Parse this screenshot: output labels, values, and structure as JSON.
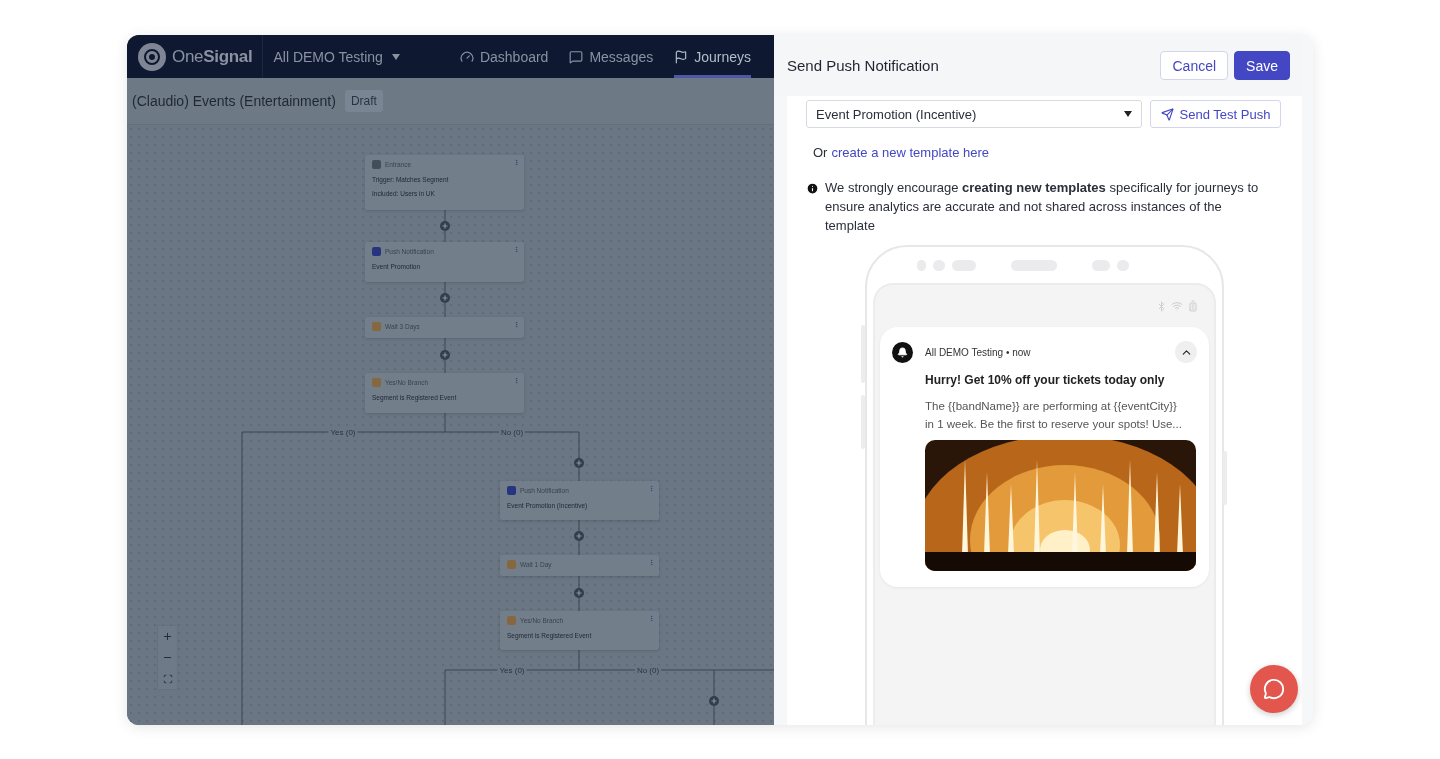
{
  "navbar": {
    "logo": "One**Signal**",
    "app_selector": "All DEMO Testing",
    "nav_items": [
      {
        "kind": "dashboard",
        "label": "Dashboard",
        "selected": false
      },
      {
        "kind": "messages",
        "label": "Messages",
        "selected": false
      },
      {
        "kind": "journeys",
        "label": "Journeys",
        "selected": true
      }
    ]
  },
  "journey": {
    "title": "(Claudio) Events (Entertainment)",
    "status": "Draft"
  },
  "canvas": {
    "nodes": [
      {
        "kind": "entrance",
        "title": "Entrance",
        "lines": [
          "Trigger: Matches Segment",
          "Included: Users in UK"
        ]
      },
      {
        "kind": "push",
        "title": "Push Notification",
        "lines": [
          "Event Promotion"
        ]
      },
      {
        "kind": "wait",
        "title": "Wait 3 Days"
      },
      {
        "kind": "branch",
        "title": "Yes/No Branch",
        "lines": [
          "Segment is Registered Event"
        ]
      },
      {
        "kind": "push",
        "title": "Push Notification",
        "lines": [
          "Event Promotion (Incentive)"
        ]
      },
      {
        "kind": "wait",
        "title": "Wait 1 Day"
      },
      {
        "kind": "branch",
        "title": "Yes/No Branch",
        "lines": [
          "Segment is Registered Event"
        ]
      }
    ],
    "branch_labels": [
      "Yes (0)",
      "No (0)",
      "Yes (0)",
      "No (0)"
    ]
  },
  "panel": {
    "title": "Send Push Notification",
    "cancel": "Cancel",
    "save": "Save",
    "template_select": "Event Promotion (Incentive)",
    "test_button": "Send Test Push",
    "link_prefix": "Or",
    "link": "create a new template here",
    "info": "We strongly encourage **creating new templates** specifically for journeys to ensure analytics are accurate and not shared across instances of the template",
    "preview": {
      "app": "All DEMO Testing • now",
      "title": "Hurry! Get 10% off your tickets today only",
      "body": "The {{bandName}} are performing at {{eventCity}} in 1 week. Be the first to reserve your spots! Use..."
    }
  }
}
